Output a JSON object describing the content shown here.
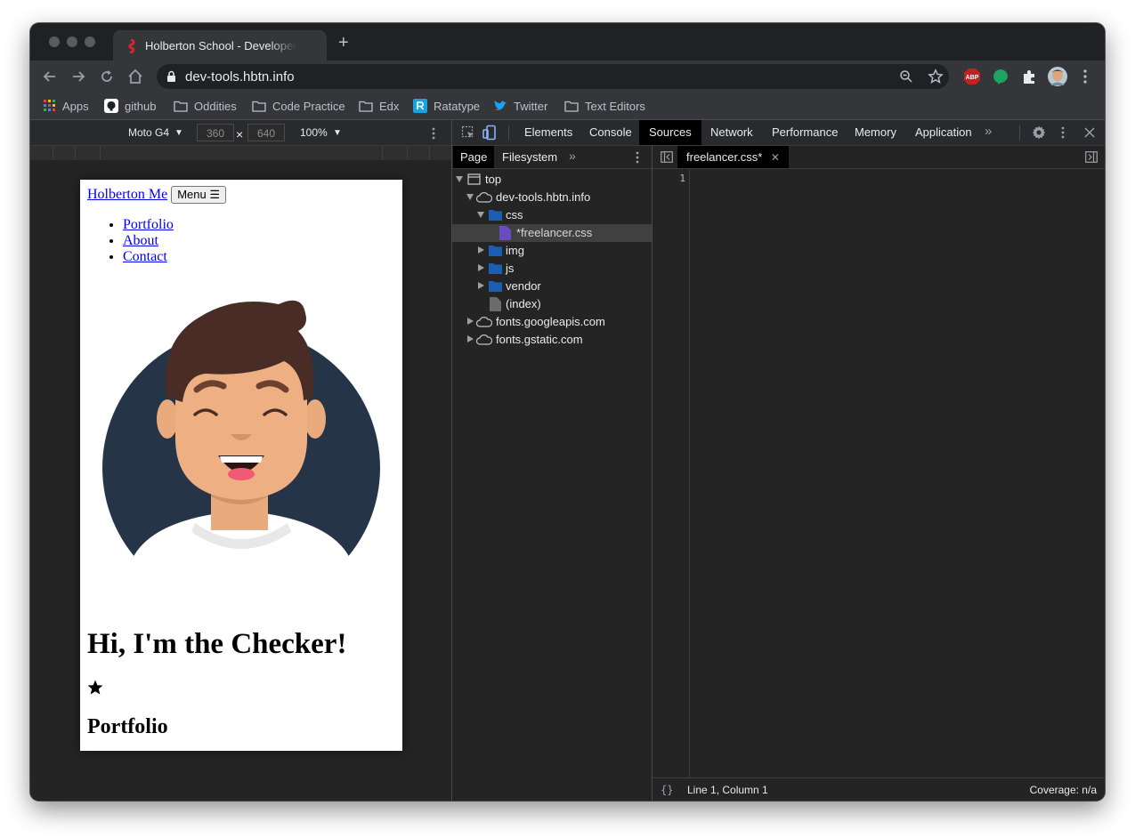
{
  "browser": {
    "tab_title": "Holberton School - Developer Tools",
    "url": "dev-tools.hbtn.info",
    "bookmarks": [
      "Apps",
      "github",
      "Oddities",
      "Code Practice",
      "Edx",
      "Ratatype",
      "Twitter",
      "Text Editors"
    ],
    "extensions": {
      "abp_label": "ABP"
    }
  },
  "device_toolbar": {
    "device": "Moto G4",
    "width": "360",
    "times": "×",
    "height": "640",
    "zoom": "100%"
  },
  "page": {
    "brand_link": "Holberton Me",
    "menu_button": "Menu",
    "nav": [
      "Portfolio",
      "About",
      "Contact"
    ],
    "heading": "Hi, I'm the Checker!",
    "section_heading": "Portfolio"
  },
  "devtools": {
    "tabs": [
      "Elements",
      "Console",
      "Sources",
      "Network",
      "Performance",
      "Memory",
      "Application"
    ],
    "active_tab": "Sources",
    "navigator_tabs": [
      "Page",
      "Filesystem"
    ],
    "tree": [
      {
        "label": "top",
        "icon": "frame"
      },
      {
        "label": "dev-tools.hbtn.info",
        "icon": "cloud"
      },
      {
        "label": "css",
        "icon": "folder"
      },
      {
        "label": "*freelancer.css",
        "icon": "file-css"
      },
      {
        "label": "img",
        "icon": "folder"
      },
      {
        "label": "js",
        "icon": "folder"
      },
      {
        "label": "vendor",
        "icon": "folder"
      },
      {
        "label": "(index)",
        "icon": "file"
      },
      {
        "label": "fonts.googleapis.com",
        "icon": "cloud"
      },
      {
        "label": "fonts.gstatic.com",
        "icon": "cloud"
      }
    ],
    "open_file": "freelancer.css*",
    "line_number": "1",
    "status": {
      "format_icon": "{}",
      "position": "Line 1, Column 1",
      "coverage": "Coverage: n/a"
    }
  },
  "colors": {
    "accent_folder": "#1a5fb4",
    "css_file": "#6a4cc2",
    "abp_red": "#c5221f",
    "green_ext": "#1ea362"
  }
}
